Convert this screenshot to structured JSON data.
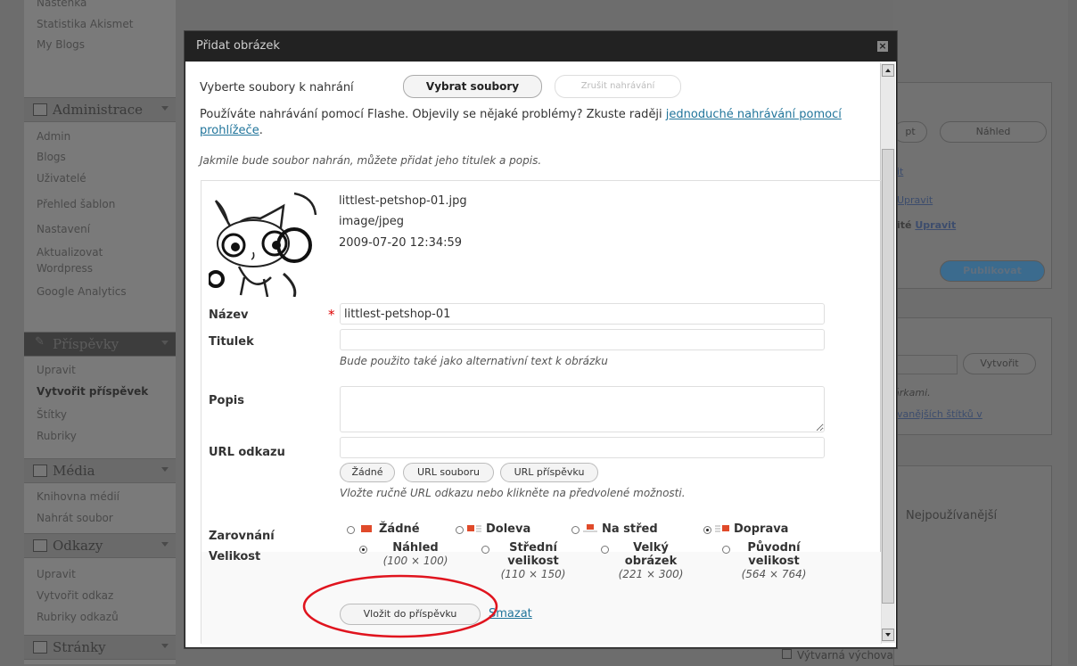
{
  "sidebar": {
    "top_items": [
      "Nástěnka",
      "Statistika Akismet",
      "My Blogs"
    ],
    "admin_header": "Administrace",
    "admin_items": [
      "Admin",
      "Blogs",
      "Uživatelé",
      "Přehled šablon",
      "Nastavení",
      "Aktualizovat Wordpress",
      "Google Analytics"
    ],
    "posts_header": "Příspěvky",
    "posts_items": [
      "Upravit",
      "Vytvořit příspěvek",
      "Štítky",
      "Rubriky"
    ],
    "media_header": "Média",
    "media_items": [
      "Knihovna médií",
      "Nahrát soubor"
    ],
    "links_header": "Odkazy",
    "links_items": [
      "Upravit",
      "Vytvořit odkaz",
      "Rubriky odkazů"
    ],
    "pages_header": "Stránky"
  },
  "right_panel": {
    "excerpt_btn": "pt",
    "preview_btn": "Náhled",
    "link_it": "it",
    "edit_link_1": "Upravit",
    "visibility_suffix": "ité",
    "edit_link_2": "Upravit",
    "publish_btn": "Publikovat",
    "create_btn": "Vytvořit",
    "commas_hint": "árkami.",
    "most_used_link": "vanějších štítků v",
    "most_used_tab": "Nejpoužívanější",
    "default_category": "Výtvarná výchova"
  },
  "modal": {
    "title": "Přidat obrázek",
    "close_glyph": "×",
    "select_label": "Vyberte soubory k nahrání",
    "select_btn": "Vybrat soubory",
    "cancel_btn": "Zrušit nahrávání",
    "flash_text": "Používáte nahrávání pomocí Flashe. Objevily se nějaké problémy? Zkuste raději ",
    "flash_link": "jednoduché nahrávání pomocí prohlížeče",
    "flash_end": ".",
    "after_upload": "Jakmile bude soubor nahrán, můžete přidat jeho titulek a popis.",
    "file": {
      "name": "littlest-petshop-01.jpg",
      "type": "image/jpeg",
      "date": "2009-07-20 12:34:59"
    },
    "fields": {
      "title_label": "Název",
      "required_mark": "*",
      "title_value": "littlest-petshop-01",
      "caption_label": "Titulek",
      "caption_value": "",
      "caption_hint": "Bude použito také jako alternativní text k obrázku",
      "desc_label": "Popis",
      "desc_value": "",
      "url_label": "URL odkazu",
      "url_value": "",
      "url_none_btn": "Žádné",
      "url_file_btn": "URL souboru",
      "url_post_btn": "URL příspěvku",
      "url_hint": "Vložte ručně URL odkazu nebo klikněte na předvolené možnosti.",
      "align_label": "Zarovnání",
      "align_options": [
        "Žádné",
        "Doleva",
        "Na střed",
        "Doprava"
      ],
      "align_selected": "Doprava",
      "size_label": "Velikost",
      "size_options": [
        {
          "line1": "Náhled",
          "line2": "",
          "dims": "(100 × 100)"
        },
        {
          "line1": "Střední",
          "line2": "velikost",
          "dims": "(110 × 150)"
        },
        {
          "line1": "Velký",
          "line2": "obrázek",
          "dims": "(221 × 300)"
        },
        {
          "line1": "Původní",
          "line2": "velikost",
          "dims": "(564 × 764)"
        }
      ],
      "size_selected": "Náhled",
      "insert_btn": "Vložit do příspěvku",
      "delete_link": "Smazat"
    }
  },
  "colors": {
    "annotation": "#e0141e",
    "link": "#21759b",
    "publish": "#3b6b8e"
  }
}
